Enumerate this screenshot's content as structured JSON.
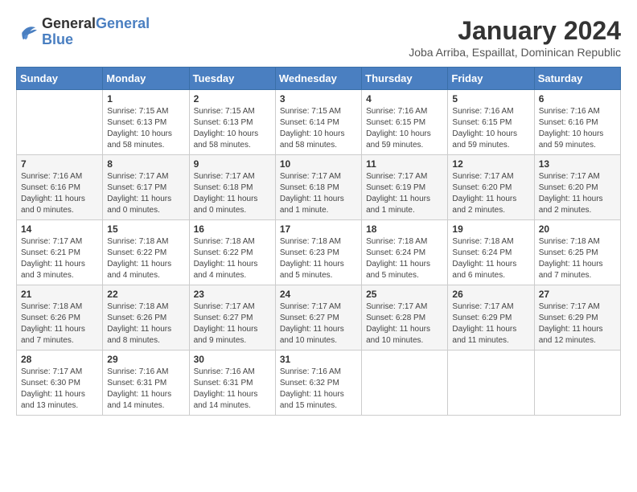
{
  "logo": {
    "line1": "General",
    "line2": "Blue"
  },
  "title": "January 2024",
  "subtitle": "Joba Arriba, Espaillat, Dominican Republic",
  "weekdays": [
    "Sunday",
    "Monday",
    "Tuesday",
    "Wednesday",
    "Thursday",
    "Friday",
    "Saturday"
  ],
  "weeks": [
    [
      {
        "day": "",
        "info": ""
      },
      {
        "day": "1",
        "info": "Sunrise: 7:15 AM\nSunset: 6:13 PM\nDaylight: 10 hours\nand 58 minutes."
      },
      {
        "day": "2",
        "info": "Sunrise: 7:15 AM\nSunset: 6:13 PM\nDaylight: 10 hours\nand 58 minutes."
      },
      {
        "day": "3",
        "info": "Sunrise: 7:15 AM\nSunset: 6:14 PM\nDaylight: 10 hours\nand 58 minutes."
      },
      {
        "day": "4",
        "info": "Sunrise: 7:16 AM\nSunset: 6:15 PM\nDaylight: 10 hours\nand 59 minutes."
      },
      {
        "day": "5",
        "info": "Sunrise: 7:16 AM\nSunset: 6:15 PM\nDaylight: 10 hours\nand 59 minutes."
      },
      {
        "day": "6",
        "info": "Sunrise: 7:16 AM\nSunset: 6:16 PM\nDaylight: 10 hours\nand 59 minutes."
      }
    ],
    [
      {
        "day": "7",
        "info": "Sunrise: 7:16 AM\nSunset: 6:16 PM\nDaylight: 11 hours\nand 0 minutes."
      },
      {
        "day": "8",
        "info": "Sunrise: 7:17 AM\nSunset: 6:17 PM\nDaylight: 11 hours\nand 0 minutes."
      },
      {
        "day": "9",
        "info": "Sunrise: 7:17 AM\nSunset: 6:18 PM\nDaylight: 11 hours\nand 0 minutes."
      },
      {
        "day": "10",
        "info": "Sunrise: 7:17 AM\nSunset: 6:18 PM\nDaylight: 11 hours\nand 1 minute."
      },
      {
        "day": "11",
        "info": "Sunrise: 7:17 AM\nSunset: 6:19 PM\nDaylight: 11 hours\nand 1 minute."
      },
      {
        "day": "12",
        "info": "Sunrise: 7:17 AM\nSunset: 6:20 PM\nDaylight: 11 hours\nand 2 minutes."
      },
      {
        "day": "13",
        "info": "Sunrise: 7:17 AM\nSunset: 6:20 PM\nDaylight: 11 hours\nand 2 minutes."
      }
    ],
    [
      {
        "day": "14",
        "info": "Sunrise: 7:17 AM\nSunset: 6:21 PM\nDaylight: 11 hours\nand 3 minutes."
      },
      {
        "day": "15",
        "info": "Sunrise: 7:18 AM\nSunset: 6:22 PM\nDaylight: 11 hours\nand 4 minutes."
      },
      {
        "day": "16",
        "info": "Sunrise: 7:18 AM\nSunset: 6:22 PM\nDaylight: 11 hours\nand 4 minutes."
      },
      {
        "day": "17",
        "info": "Sunrise: 7:18 AM\nSunset: 6:23 PM\nDaylight: 11 hours\nand 5 minutes."
      },
      {
        "day": "18",
        "info": "Sunrise: 7:18 AM\nSunset: 6:24 PM\nDaylight: 11 hours\nand 5 minutes."
      },
      {
        "day": "19",
        "info": "Sunrise: 7:18 AM\nSunset: 6:24 PM\nDaylight: 11 hours\nand 6 minutes."
      },
      {
        "day": "20",
        "info": "Sunrise: 7:18 AM\nSunset: 6:25 PM\nDaylight: 11 hours\nand 7 minutes."
      }
    ],
    [
      {
        "day": "21",
        "info": "Sunrise: 7:18 AM\nSunset: 6:26 PM\nDaylight: 11 hours\nand 7 minutes."
      },
      {
        "day": "22",
        "info": "Sunrise: 7:18 AM\nSunset: 6:26 PM\nDaylight: 11 hours\nand 8 minutes."
      },
      {
        "day": "23",
        "info": "Sunrise: 7:17 AM\nSunset: 6:27 PM\nDaylight: 11 hours\nand 9 minutes."
      },
      {
        "day": "24",
        "info": "Sunrise: 7:17 AM\nSunset: 6:27 PM\nDaylight: 11 hours\nand 10 minutes."
      },
      {
        "day": "25",
        "info": "Sunrise: 7:17 AM\nSunset: 6:28 PM\nDaylight: 11 hours\nand 10 minutes."
      },
      {
        "day": "26",
        "info": "Sunrise: 7:17 AM\nSunset: 6:29 PM\nDaylight: 11 hours\nand 11 minutes."
      },
      {
        "day": "27",
        "info": "Sunrise: 7:17 AM\nSunset: 6:29 PM\nDaylight: 11 hours\nand 12 minutes."
      }
    ],
    [
      {
        "day": "28",
        "info": "Sunrise: 7:17 AM\nSunset: 6:30 PM\nDaylight: 11 hours\nand 13 minutes."
      },
      {
        "day": "29",
        "info": "Sunrise: 7:16 AM\nSunset: 6:31 PM\nDaylight: 11 hours\nand 14 minutes."
      },
      {
        "day": "30",
        "info": "Sunrise: 7:16 AM\nSunset: 6:31 PM\nDaylight: 11 hours\nand 14 minutes."
      },
      {
        "day": "31",
        "info": "Sunrise: 7:16 AM\nSunset: 6:32 PM\nDaylight: 11 hours\nand 15 minutes."
      },
      {
        "day": "",
        "info": ""
      },
      {
        "day": "",
        "info": ""
      },
      {
        "day": "",
        "info": ""
      }
    ]
  ]
}
